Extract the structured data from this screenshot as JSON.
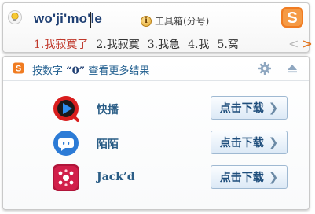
{
  "ime": {
    "composition": "wo'ji'mo'le",
    "toolbox_hint": "工具箱(分号)",
    "candidates": [
      {
        "label": "1.我寂寞了"
      },
      {
        "label": "2.我寂寞"
      },
      {
        "label": "3.我急"
      },
      {
        "label": "4.我"
      },
      {
        "label": "5.窝"
      }
    ],
    "pager": {
      "prev": "<",
      "next": ">"
    },
    "logo_letter": "S"
  },
  "panel": {
    "header_prefix": "按数字",
    "header_key": "“0”",
    "header_suffix": "查看更多结果",
    "apps": [
      {
        "name": "快播",
        "button": "点击下载",
        "icon": "kuaibo-play-icon"
      },
      {
        "name": "陌陌",
        "button": "点击下载",
        "icon": "momo-chat-icon"
      },
      {
        "name": "Jack’d",
        "button": "点击下载",
        "icon": "jackd-icon"
      }
    ]
  },
  "colors": {
    "accent_orange": "#f07c22",
    "first_candidate": "#c0382b",
    "link_blue": "#1f5d8e"
  }
}
